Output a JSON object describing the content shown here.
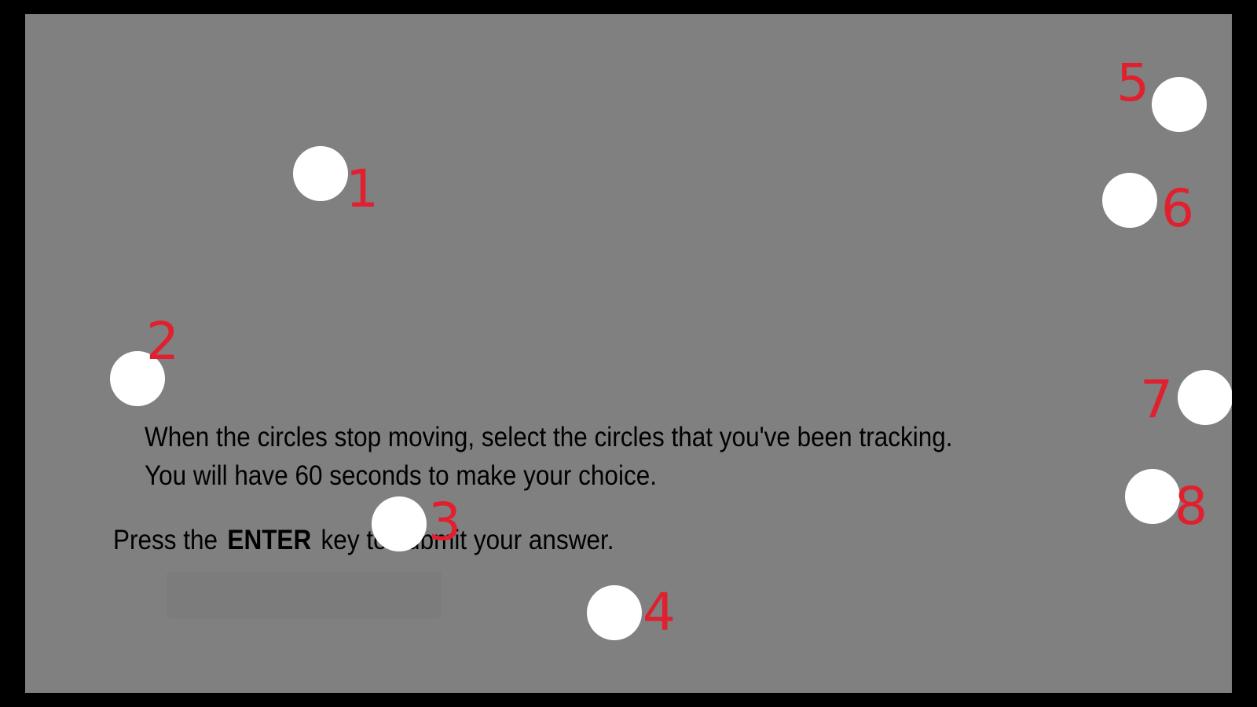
{
  "colors": {
    "background": "#000000",
    "stage": "#808080",
    "circle": "#ffffff",
    "label": "#e0202e",
    "text": "#000000"
  },
  "circles": [
    {
      "label": "1"
    },
    {
      "label": "2"
    },
    {
      "label": "3"
    },
    {
      "label": "4"
    },
    {
      "label": "5"
    },
    {
      "label": "6"
    },
    {
      "label": "7"
    },
    {
      "label": "8"
    }
  ],
  "instructions": {
    "line1": "When the circles stop moving, select the circles that you've been tracking.",
    "line2": "You will have 60 seconds to make your choice.",
    "press_prefix": "Press the",
    "key_name": "ENTER",
    "press_suffix": "key to submit your answer."
  }
}
